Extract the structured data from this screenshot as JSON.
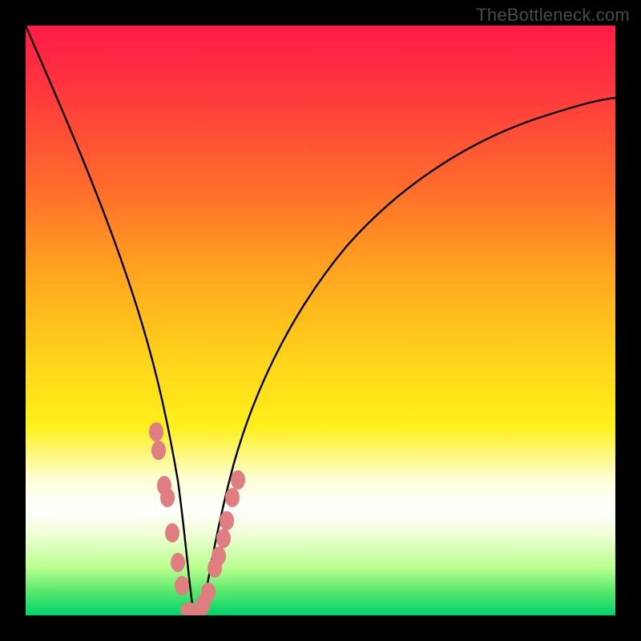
{
  "watermark": {
    "text": "TheBottleneck.com"
  },
  "chart_data": {
    "type": "line",
    "title": "",
    "xlabel": "",
    "ylabel": "",
    "xlim": [
      0,
      1
    ],
    "ylim": [
      0,
      1
    ],
    "series": [
      {
        "name": "bottleneck-curve",
        "x": [
          0.0,
          0.05,
          0.1,
          0.15,
          0.18,
          0.21,
          0.235,
          0.255,
          0.27,
          0.283,
          0.295,
          0.31,
          0.335,
          0.36,
          0.4,
          0.45,
          0.52,
          0.6,
          0.7,
          0.8,
          0.9,
          1.0
        ],
        "y": [
          1.0,
          0.86,
          0.72,
          0.56,
          0.45,
          0.33,
          0.21,
          0.11,
          0.04,
          0.0,
          0.0,
          0.03,
          0.12,
          0.22,
          0.34,
          0.45,
          0.56,
          0.65,
          0.74,
          0.8,
          0.84,
          0.87
        ]
      }
    ],
    "markers": {
      "name": "data-points",
      "x": [
        0.221,
        0.225,
        0.235,
        0.24,
        0.248,
        0.258,
        0.265,
        0.278,
        0.293,
        0.302,
        0.31,
        0.32,
        0.328,
        0.335,
        0.341,
        0.35,
        0.36
      ],
      "y": [
        0.31,
        0.28,
        0.22,
        0.2,
        0.14,
        0.09,
        0.05,
        0.01,
        0.01,
        0.02,
        0.04,
        0.08,
        0.1,
        0.13,
        0.16,
        0.2,
        0.23
      ]
    },
    "colors": {
      "curve_stroke": "#000000",
      "marker_fill": "#e07d80",
      "gradient_top": "#ff1a47",
      "gradient_bottom": "#00d56a"
    }
  }
}
